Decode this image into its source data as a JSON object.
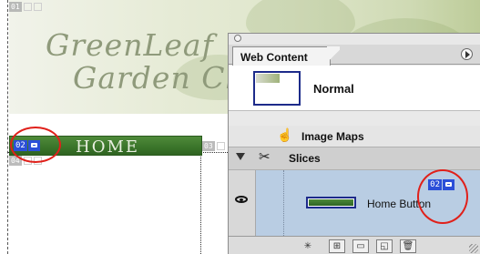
{
  "document": {
    "logo_line1": "GreenLeaf",
    "logo_line2": "Garden Club",
    "home_button_text": "HOME",
    "slice_tags": {
      "s01": "01",
      "s02": "02",
      "s03": "03",
      "s04": "04"
    },
    "colors": {
      "home_button": "#3a742a",
      "slice_active": "#2b4fd8",
      "highlight_circle": "#e0201a"
    }
  },
  "panel": {
    "tab_label": "Web Content",
    "rows": {
      "normal": "Normal",
      "image_maps": "Image Maps",
      "slices": "Slices",
      "home_button": "Home Button",
      "home_button_slice": "02"
    },
    "icons": [
      "close-icon",
      "panel-menu-icon",
      "hand-icon",
      "slice-tool-icon",
      "eye-icon",
      "disclosure-triangle-icon"
    ],
    "toolbar_icons": [
      "magic-wand-icon",
      "new-layer-icon",
      "new-folder-icon",
      "duplicate-icon",
      "trash-icon"
    ],
    "colors": {
      "selected_row": "#b9cde3",
      "panel_bg": "#e9e9e9"
    }
  }
}
